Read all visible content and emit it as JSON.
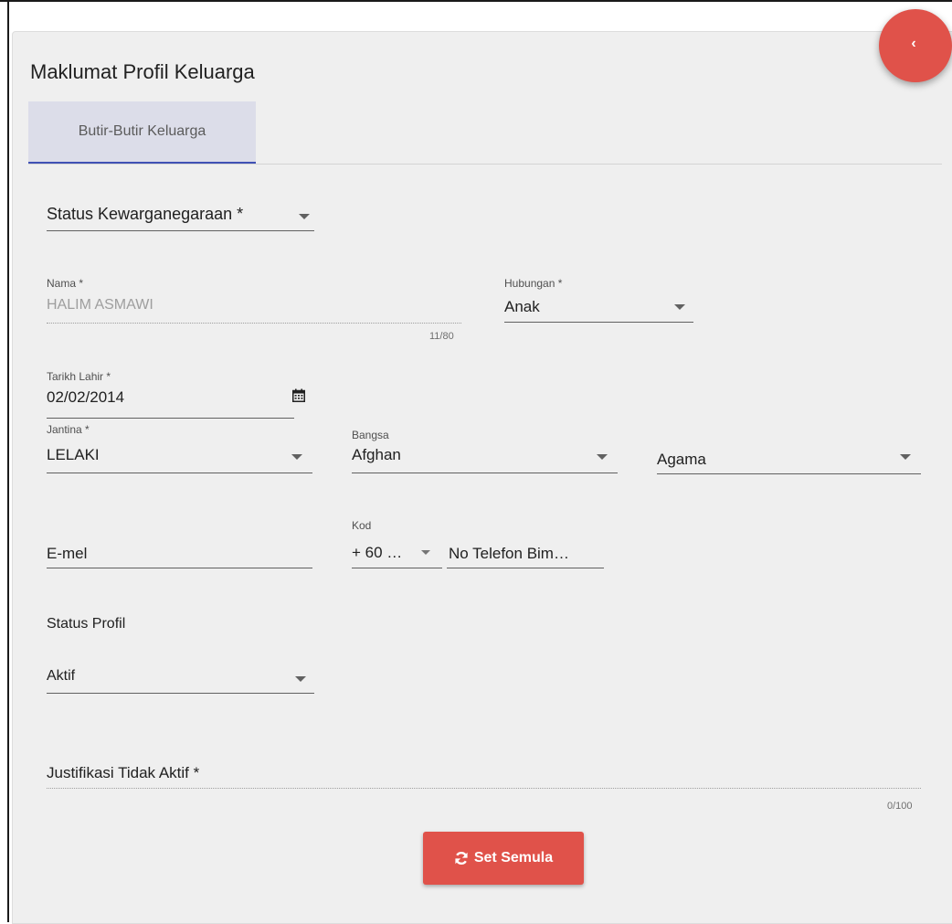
{
  "header": {
    "title": "Maklumat Profil Keluarga",
    "back_icon": "chevron-left-icon",
    "back_label": "‹"
  },
  "tabs": [
    {
      "label": "Butir-Butir Keluarga",
      "active": true
    }
  ],
  "form": {
    "status_kewarganegaraan": {
      "label": "Status Kewarganegaraan *"
    },
    "nama": {
      "label": "Nama *",
      "value": "HALIM ASMAWI",
      "counter": "11/80"
    },
    "hubungan": {
      "label": "Hubungan *",
      "value": "Anak"
    },
    "tarikh_lahir": {
      "label": "Tarikh Lahir *",
      "value": "02/02/2014",
      "icon": "calendar-icon"
    },
    "jantina": {
      "label": "Jantina *",
      "value": "LELAKI"
    },
    "bangsa": {
      "label": "Bangsa",
      "value": "Afghan"
    },
    "agama": {
      "placeholder": "Agama"
    },
    "emel": {
      "placeholder": "E-mel"
    },
    "kod": {
      "label": "Kod",
      "value": "+ 60 …"
    },
    "no_telefon": {
      "placeholder": "No Telefon Bim…"
    },
    "status_profil": {
      "label": "Status Profil",
      "value": "Aktif"
    },
    "justifikasi": {
      "placeholder": "Justifikasi Tidak Aktif *",
      "counter": "0/100"
    }
  },
  "actions": {
    "reset_label": "Set Semula",
    "reset_icon": "refresh-icon"
  },
  "colors": {
    "accent_red": "#e0524a",
    "tab_indicator": "#3f51b5",
    "tab_background": "#dcdde9",
    "card_background": "#efefef"
  }
}
